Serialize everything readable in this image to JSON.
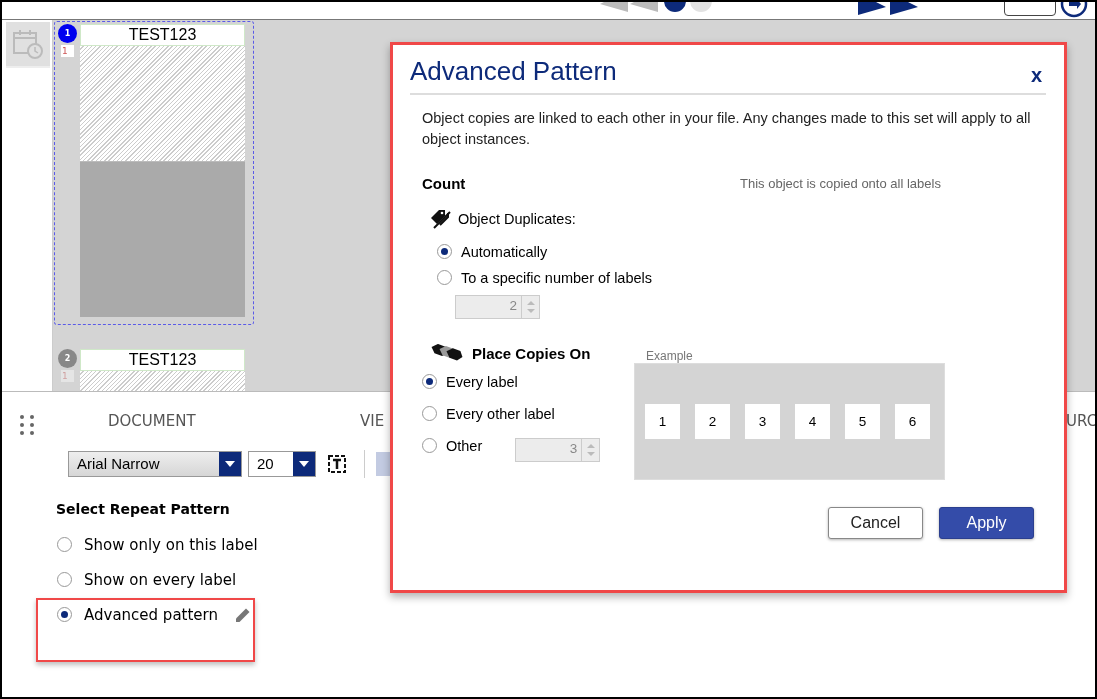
{
  "toolbar": {
    "pages": [
      {
        "selected": true
      },
      {
        "selected": false
      }
    ]
  },
  "labels": [
    {
      "number": "1",
      "selected": true,
      "quantity": "1",
      "text": "TEST123"
    },
    {
      "number": "2",
      "selected": false,
      "quantity": "1",
      "text": "TEST123"
    }
  ],
  "panel": {
    "tabs": [
      "DOCUMENT",
      "VIE",
      "URC"
    ],
    "font": "Arial Narrow",
    "size": "20",
    "heading": "Select Repeat Pattern",
    "options": [
      {
        "label": "Show only on this label",
        "selected": false
      },
      {
        "label": "Show on every label",
        "selected": false
      },
      {
        "label": "Advanced pattern",
        "selected": true
      }
    ]
  },
  "dialog": {
    "title": "Advanced Pattern",
    "close": "x",
    "intro": "Object copies are linked to each other in your file. Any changes made to this set will apply to all object instances.",
    "count_heading": "Count",
    "note": "This object is copied onto all labels",
    "duplicates_label": "Object Duplicates:",
    "duplicate_options": [
      {
        "label": "Automatically",
        "selected": true
      },
      {
        "label": "To a specific number of labels",
        "selected": false
      }
    ],
    "duplicate_count": "2",
    "place_heading": "Place Copies On",
    "place_options": [
      {
        "label": "Every label",
        "selected": true
      },
      {
        "label": "Every other label",
        "selected": false
      },
      {
        "label": "Other",
        "selected": false
      }
    ],
    "other_count": "3",
    "example_label": "Example",
    "example_cells": [
      "1",
      "2",
      "3",
      "4",
      "5",
      "6"
    ],
    "buttons": [
      {
        "label": "Cancel",
        "kind": "secondary"
      },
      {
        "label": "Apply",
        "kind": "primary"
      }
    ]
  }
}
